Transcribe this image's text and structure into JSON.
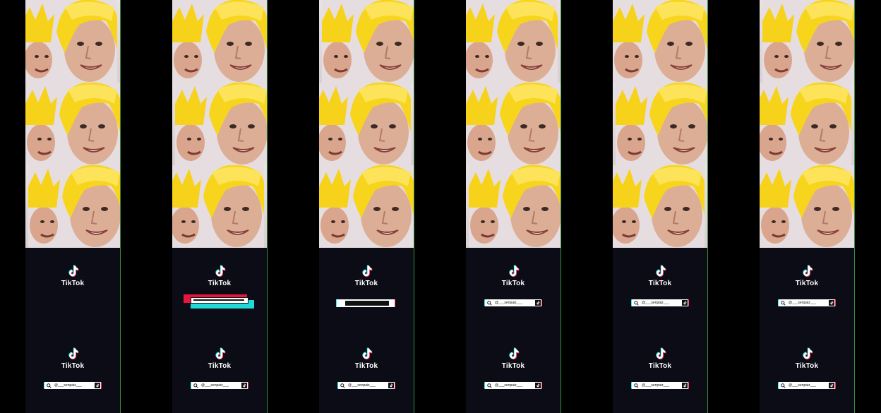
{
  "brand": {
    "name": "TikTok"
  },
  "search": {
    "handle": "@___senpaiz___"
  },
  "colors": {
    "tiktok_cyan": "#25f4ee",
    "tiktok_red": "#fe2c55",
    "panel_bg": "#0b0c16",
    "divider": "#3a8f3a"
  },
  "icons": {
    "logo": "tiktok-note-icon",
    "search": "search-icon"
  }
}
